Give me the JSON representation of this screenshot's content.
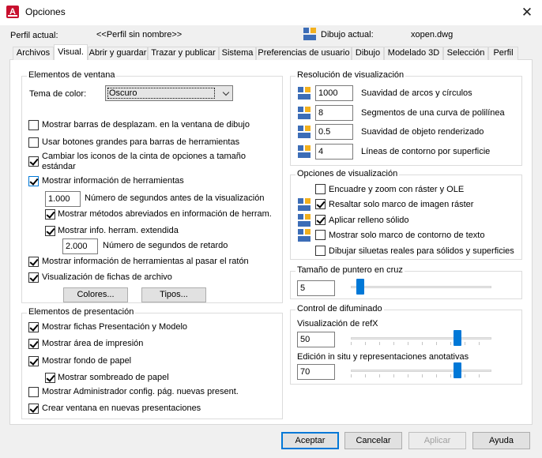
{
  "window": {
    "title": "Opciones",
    "app_icon_letter": "A"
  },
  "profile": {
    "label": "Perfil actual:",
    "value": "<<Perfil sin nombre>>"
  },
  "drawing": {
    "label": "Dibujo actual:",
    "value": "xopen.dwg"
  },
  "tabs": [
    "Archivos",
    "Visual.",
    "Abrir y guardar",
    "Trazar y publicar",
    "Sistema",
    "Preferencias de usuario",
    "Dibujo",
    "Modelado 3D",
    "Selección",
    "Perfil"
  ],
  "active_tab": "Visual.",
  "window_elements": {
    "title": "Elementos de ventana",
    "color_theme_label": "Tema de color:",
    "color_theme_value": "Oscuro",
    "scrollbars": "Mostrar barras de desplazam. en la ventana de dibujo",
    "large_buttons": "Usar botones grandes para barras de herramientas",
    "resize_ribbon_line1": "Cambiar los iconos de la cinta de opciones a tamaño",
    "resize_ribbon_line2": "estándar",
    "show_tooltips": "Mostrar información de herramientas",
    "delay_value": "1.000",
    "delay_label": "Número de segundos antes de la visualización",
    "shortcut_keys": "Mostrar métodos abreviados en información de herram.",
    "extended_tooltips": "Mostrar info. herram. extendida",
    "ext_delay_value": "2.000",
    "ext_delay_label": "Número de segundos de retardo",
    "rollover_tooltips": "Mostrar información de herramientas al pasar el ratón",
    "file_tabs": "Visualización de fichas de archivo",
    "colors_button": "Colores...",
    "fonts_button": "Tipos..."
  },
  "layout_elements": {
    "title": "Elementos de presentación",
    "layout_tabs": "Mostrar fichas Presentación y Modelo",
    "printable_area": "Mostrar área de impresión",
    "paper_background": "Mostrar fondo de papel",
    "paper_shadow": "Mostrar sombreado de papel",
    "page_setup_manager": "Mostrar Administrador config. pág. nuevas present.",
    "create_viewport": "Crear ventana en nuevas presentaciones"
  },
  "display_resolution": {
    "title": "Resolución de visualización",
    "rows": [
      {
        "value": "1000",
        "label": "Suavidad de arcos y círculos"
      },
      {
        "value": "8",
        "label": "Segmentos de una curva de polilínea"
      },
      {
        "value": "0.5",
        "label": "Suavidad de objeto renderizado"
      },
      {
        "value": "4",
        "label": "Líneas de contorno por superficie"
      }
    ]
  },
  "display_performance": {
    "title": "Opciones de visualización",
    "pan_zoom_raster": "Encuadre y zoom con ráster y OLE",
    "highlight_raster_frame": "Resaltar solo marco de imagen ráster",
    "apply_solid_fill": "Aplicar relleno sólido",
    "text_boundary_frame": "Mostrar solo marco de contorno de texto",
    "true_silhouettes": "Dibujar siluetas reales para sólidos y superficies"
  },
  "crosshair": {
    "title": "Tamaño de puntero en cruz",
    "value": "5",
    "level_fraction": 0.05
  },
  "fade_control": {
    "title": "Control de difuminado",
    "xref_label": "Visualización de refX",
    "xref_value": "50",
    "inplace_label": "Edición in situ y representaciones anotativas",
    "inplace_value": "70"
  },
  "buttons": {
    "ok": "Aceptar",
    "cancel": "Cancelar",
    "apply": "Aplicar",
    "help": "Ayuda"
  },
  "colors": {
    "accent": "#0078d7",
    "app_red": "#c8102e",
    "drawing_icon_blue": "#3c6db7",
    "drawing_icon_yellow": "#f2b01e"
  }
}
